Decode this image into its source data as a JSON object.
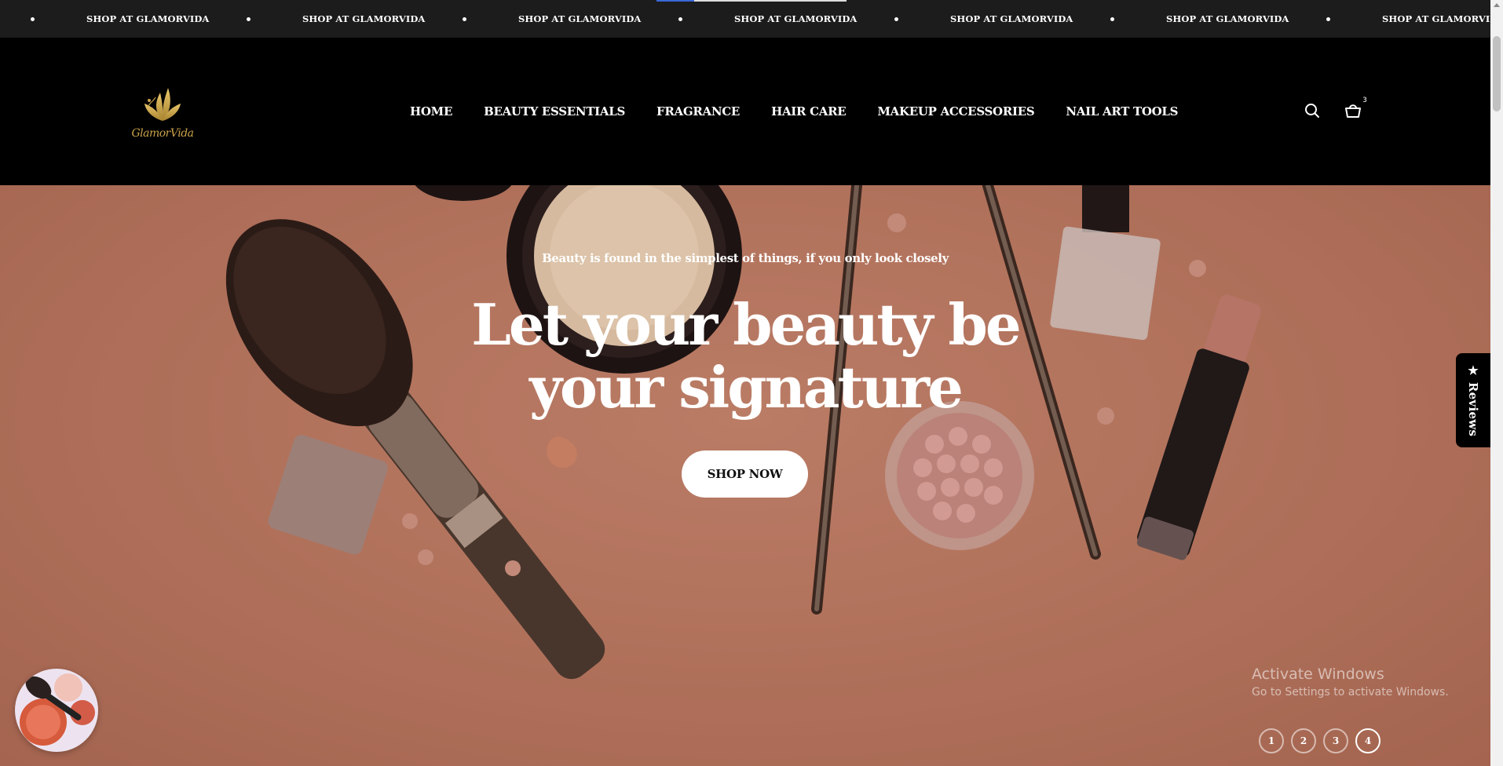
{
  "announcement": {
    "items": [
      "SHOP AT GLAMORVIDA",
      "SHOP AT GLAMORVIDA",
      "SHOP AT GLAMORVIDA",
      "SHOP AT GLAMORVIDA",
      "SHOP AT GLAMORVIDA",
      "SHOP AT GLAMORVIDA",
      "SHOP AT GLAMORVIDA"
    ]
  },
  "header": {
    "logo_text": "GlamorVida",
    "nav": [
      "HOME",
      "BEAUTY ESSENTIALS",
      "FRAGRANCE",
      "HAIR CARE",
      "MAKEUP ACCESSORIES",
      "NAIL ART TOOLS"
    ],
    "cart_count": "3"
  },
  "hero": {
    "tagline": "Beauty is found in the simplest of things, if you only look closely",
    "headline_line1": "Let your beauty be",
    "headline_line2": "your signature",
    "cta": "SHOP NOW",
    "slides": [
      "1",
      "2",
      "3",
      "4"
    ],
    "active_slide": "4"
  },
  "reviews_tab": {
    "label": "★ Reviews"
  },
  "watermark": {
    "line1": "Activate Windows",
    "line2": "Go to Settings to activate Windows."
  },
  "colors": {
    "hero_bg": "#c1806a",
    "header_bg": "#000000",
    "marquee_bg": "#1c1c1c",
    "logo_gold": "#c9a24a"
  },
  "icons": [
    "search-icon",
    "cart-icon",
    "star-icon"
  ]
}
